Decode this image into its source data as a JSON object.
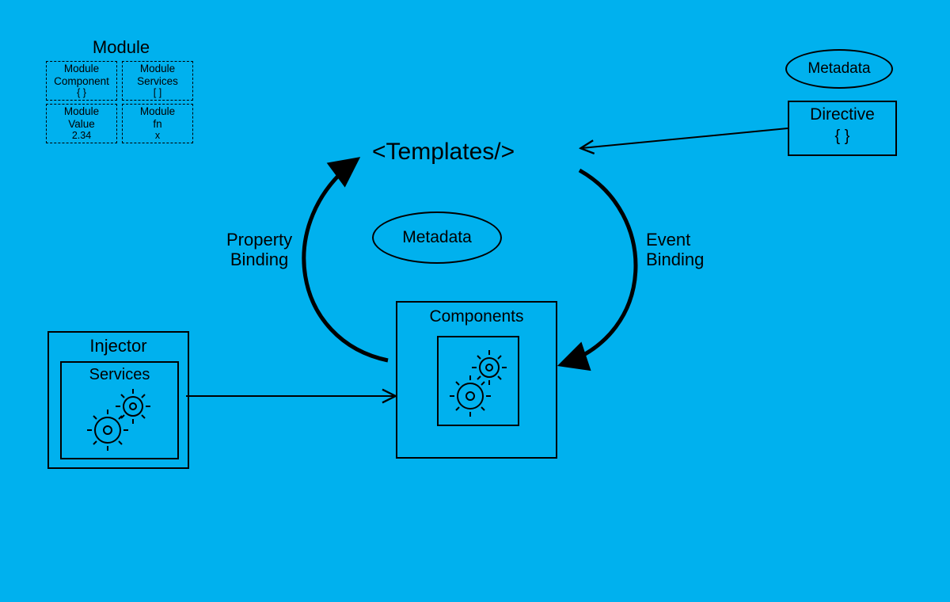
{
  "colors": {
    "background": "#00b1ee",
    "stroke": "#000000"
  },
  "module_panel": {
    "title": "Module",
    "cells": {
      "component": {
        "line1": "Module",
        "line2": "Component",
        "sub": "{ }"
      },
      "services": {
        "line1": "Module",
        "line2": "Services",
        "sub": "[ ]"
      },
      "value": {
        "line1": "Module",
        "line2": "Value",
        "sub": "2.34"
      },
      "fn": {
        "line1": "Module",
        "line2": "fn",
        "sub": "x"
      }
    }
  },
  "templates_label": "<Templates/>",
  "metadata_center_label": "Metadata",
  "metadata_top_label": "Metadata",
  "directive": {
    "title": "Directive",
    "sub": "{ }"
  },
  "property_binding_label": "Property\nBinding",
  "event_binding_label": "Event\nBinding",
  "components": {
    "title": "Components"
  },
  "injector": {
    "title": "Injector",
    "services_title": "Services"
  }
}
